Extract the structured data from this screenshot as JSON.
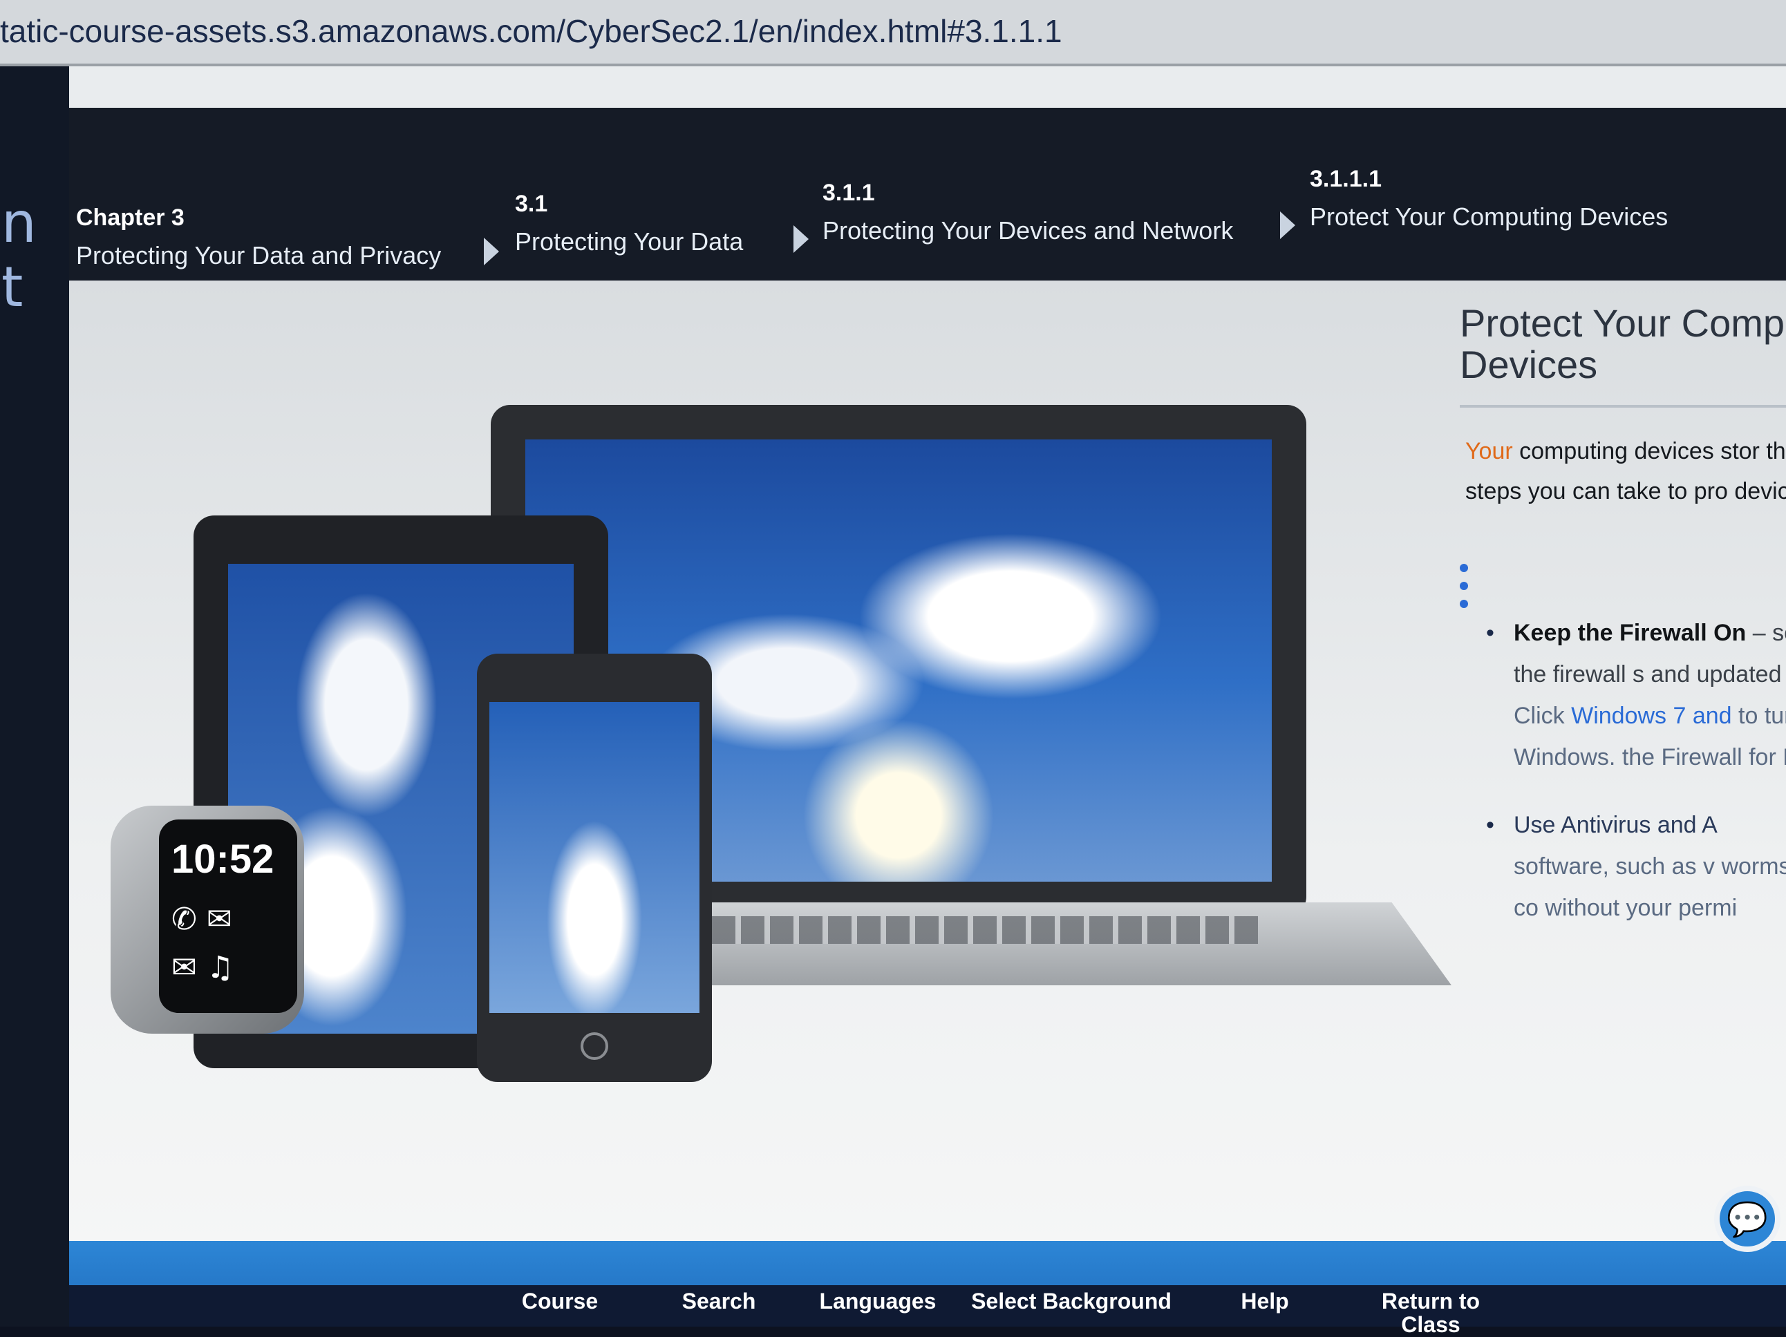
{
  "browser": {
    "url": "tatic-course-assets.s3.amazonaws.com/CyberSec2.1/en/index.html#3.1.1.1"
  },
  "left_fragment": "n t",
  "breadcrumb": [
    {
      "num": "Chapter 3",
      "title": "Protecting Your Data and Privacy"
    },
    {
      "num": "3.1",
      "title": "Protecting Your Data"
    },
    {
      "num": "3.1.1",
      "title": "Protecting Your Devices and Network"
    },
    {
      "num": "3.1.1.1",
      "title": "Protect Your Computing Devices"
    }
  ],
  "watch": {
    "time": "10:52"
  },
  "content": {
    "title_line1": "Protect Your Comp",
    "title_line2": "Devices",
    "intro_accent": "Your",
    "intro_rest": " computing devices stor the portal to your online life. of steps you can take to pro devices from intrusion:",
    "bullet1_bold": "Keep the Firewall On",
    "bullet1_text": " – software firewall or a h a router, the firewall s and updated to preve accessing your perso ",
    "bullet1_click": "Click ",
    "bullet1_link": "Windows 7 and",
    "bullet1_tail": " to turn on the firewal version of Windows. the Firewall for Mac",
    "bullet2_bold": "Use Antivirus and A",
    "bullet2_text": "software, such as v worms, ransomwar installed on your co without your permi"
  },
  "bottom_nav": {
    "course": "Course",
    "search": "Search",
    "languages": "Languages",
    "select_background": "Select Background",
    "help": "Help",
    "return": "Return to Class"
  },
  "icons": {
    "crumb_separator": "triangle-right-icon",
    "chat": "chat-icon",
    "watch_call": "phone-icon",
    "watch_message": "message-icon",
    "watch_mail": "mail-icon",
    "watch_headset": "headset-icon"
  },
  "colors": {
    "header_bg": "#151b26",
    "accent_orange": "#e06a1a",
    "link_blue": "#2a6bd6",
    "band_blue": "#2d86d6"
  }
}
